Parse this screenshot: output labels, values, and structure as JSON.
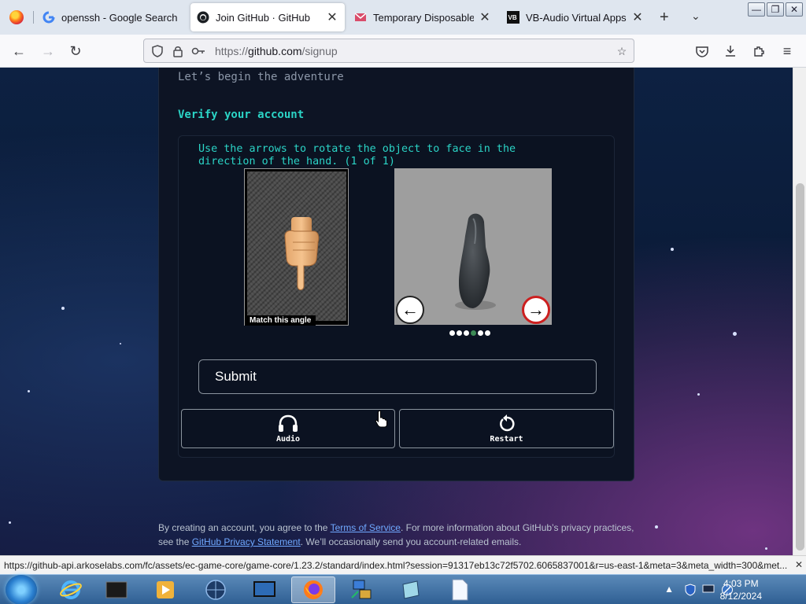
{
  "browser": {
    "tabs": [
      {
        "label": "openssh - Google Search",
        "favicon": "google-icon"
      },
      {
        "label": "Join GitHub · GitHub",
        "favicon": "github-icon",
        "active": true
      },
      {
        "label": "Temporary Disposable Gm",
        "favicon": "mail-icon"
      },
      {
        "label": "VB-Audio Virtual Apps",
        "favicon": "vb-icon"
      }
    ],
    "url_scheme": "https://",
    "url_host": "github.com",
    "url_path": "/signup",
    "status_url": "https://github-api.arkoselabs.com/fc/assets/ec-game-core/game-core/1.23.2/standard/index.html?session=91317eb13c72f5702.6065837001&r=us-east-1&meta=3&meta_width=300&met..."
  },
  "page": {
    "subtitle": "Let’s begin the adventure",
    "verify_heading": "Verify your account",
    "instruction": "Use the arrows to rotate the object to face in the direction of the hand. (1 of 1)",
    "hand_caption": "Match this angle",
    "carousel": {
      "count": 6,
      "active_index": 3
    },
    "submit_label": "Submit",
    "audio_label": "Audio",
    "restart_label": "Restart",
    "footer": {
      "line1_prefix": "By creating an account, you agree to the ",
      "terms_link": "Terms of Service",
      "line1_suffix": ". For more information about GitHub’s privacy practices,",
      "line2_prefix": "see the ",
      "privacy_link": "GitHub Privacy Statement",
      "line2_suffix": ". We’ll occasionally send you account-related emails."
    },
    "colors": {
      "accent": "#2bd4c6",
      "card": "#0d1424",
      "link": "#6fa8ff"
    }
  },
  "taskbar": {
    "time": "4:03 PM",
    "date": "8/12/2024"
  }
}
